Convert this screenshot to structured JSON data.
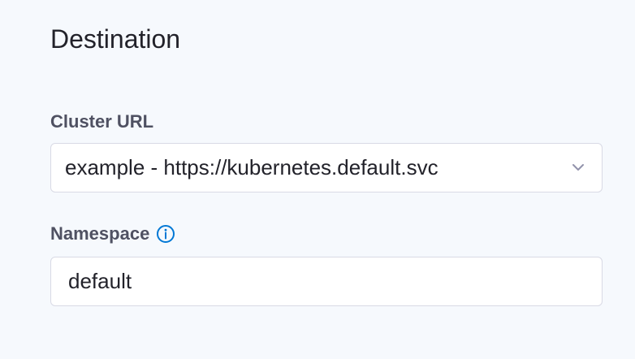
{
  "section": {
    "title": "Destination"
  },
  "cluster": {
    "label": "Cluster URL",
    "value": "example - https://kubernetes.default.svc",
    "icon": "chevron-down-icon"
  },
  "namespace": {
    "label": "Namespace",
    "value": "default",
    "icon": "info-icon"
  },
  "colors": {
    "background": "#f6f9fd",
    "field_border": "#d9dae5",
    "label": "#4f5162",
    "info_icon": "#0278d5"
  }
}
